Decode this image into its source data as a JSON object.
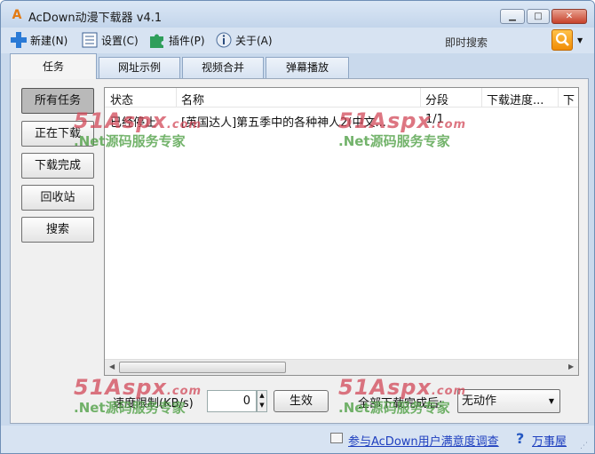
{
  "window": {
    "title": "AcDown动漫下载器 v4.1"
  },
  "toolbar": {
    "new_label": "新建(N)",
    "settings_label": "设置(C)",
    "plugins_label": "插件(P)",
    "about_label": "关于(A)",
    "search_label": "即时搜索"
  },
  "tabs": [
    {
      "label": "任务",
      "active": true
    },
    {
      "label": "网址示例",
      "active": false
    },
    {
      "label": "视频合并",
      "active": false
    },
    {
      "label": "弹幕播放",
      "active": false
    }
  ],
  "sidebar": {
    "items": [
      {
        "label": "所有任务",
        "active": true
      },
      {
        "label": "正在下载",
        "active": false
      },
      {
        "label": "下载完成",
        "active": false
      },
      {
        "label": "回收站",
        "active": false
      },
      {
        "label": "搜索",
        "active": false
      }
    ]
  },
  "task_list": {
    "columns": [
      "状态",
      "名称",
      "分段",
      "下载进度...",
      "下"
    ],
    "rows": [
      {
        "status": "已经停止",
        "name": "[英国达人]第五季中的各种神人2(中文...",
        "segment": "1/1",
        "progress": ""
      }
    ]
  },
  "controls": {
    "speed_label": "速度限制(KB/s)",
    "speed_value": "0",
    "apply_label": "生效",
    "after_label": "全部下载完成后:",
    "after_value": "无动作"
  },
  "statusbar": {
    "survey_link": "参与AcDown用户满意度调查",
    "help_link": "万事屋"
  },
  "watermark": {
    "logo": "51Aspx",
    "logo_suffix": ".com",
    "tagline": ".Net源码服务专家"
  },
  "colors": {
    "accent": "#2558c2",
    "watermark_red": "#d14858",
    "watermark_green": "#50a046"
  }
}
